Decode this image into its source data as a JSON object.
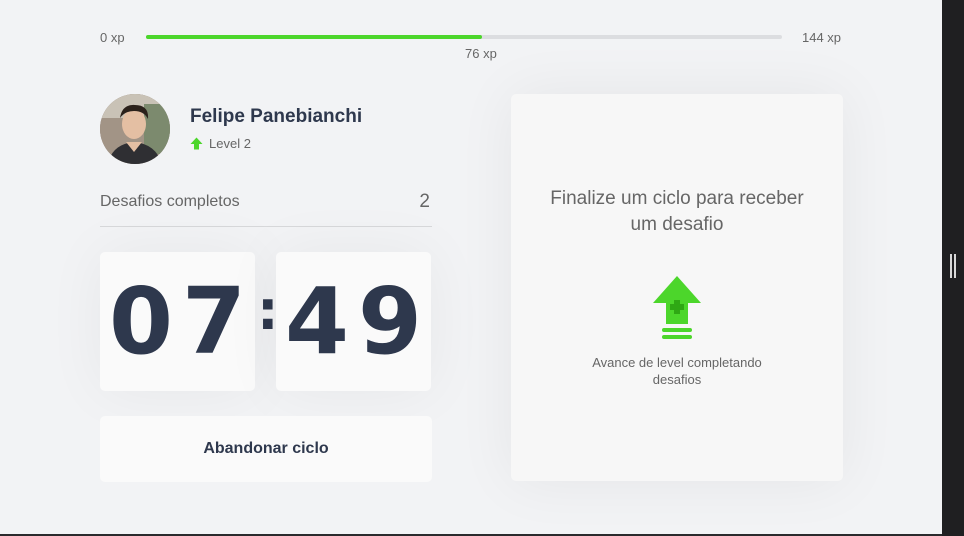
{
  "xp": {
    "min_label": "0 xp",
    "max_label": "144 xp",
    "current_label": "76 xp",
    "progress_fraction": 0.528,
    "bar_color": "#4cd62b"
  },
  "profile": {
    "name": "Felipe Panebianchi",
    "level_label": "Level 2",
    "level_icon": "level-up-arrow-icon"
  },
  "completed": {
    "label": "Desafios completos",
    "count": "2"
  },
  "countdown": {
    "minute_tens": "0",
    "minute_ones": "7",
    "separator": ":",
    "second_tens": "4",
    "second_ones": "9"
  },
  "abandon_button": {
    "label": "Abandonar ciclo"
  },
  "challenge_card": {
    "title": "Finalize um ciclo para receber um desafio",
    "icon": "level-up-icon",
    "description": "Avance de level completando desafios"
  },
  "colors": {
    "background": "#f2f3f5",
    "title_text": "#2e384d",
    "body_text": "#666666",
    "accent_green": "#4cd62b"
  }
}
